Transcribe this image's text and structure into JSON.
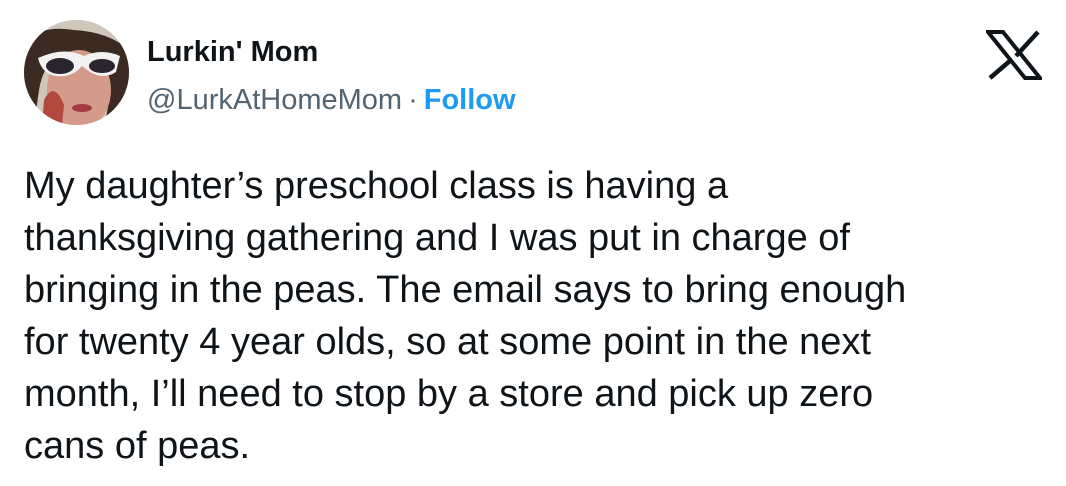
{
  "author": {
    "display_name": "Lurkin' Mom",
    "handle": "@LurkAtHomeMom",
    "separator": "·",
    "follow_label": "Follow"
  },
  "icons": {
    "avatar": "profile-photo",
    "platform_logo": "x-logo-icon"
  },
  "colors": {
    "follow_link": "#1d9bf0",
    "handle": "#536471",
    "text": "#0f1419"
  },
  "tweet": {
    "text": "My daughter’s preschool class is having a\nthanksgiving gathering and I was put in charge of\nbringing in the peas. The email says to bring enough\nfor twenty 4 year olds, so at some point in the next\nmonth, I’ll need to stop by a store and pick up zero\ncans of peas."
  }
}
